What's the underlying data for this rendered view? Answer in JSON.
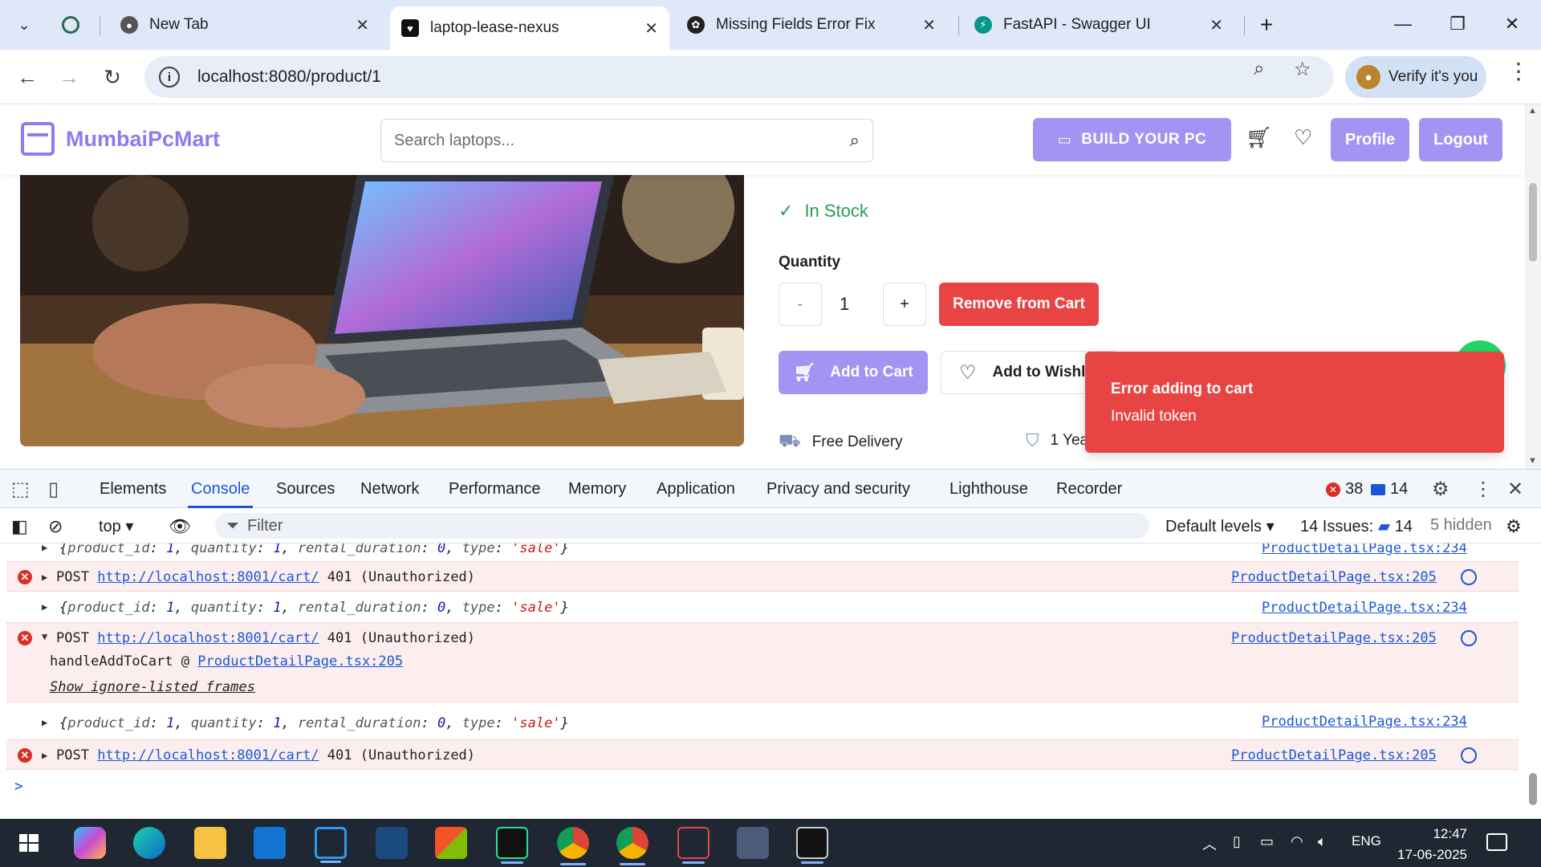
{
  "browser": {
    "tabs": [
      {
        "title": "New Tab",
        "favicon": "chrome-icon",
        "active": false
      },
      {
        "title": "laptop-lease-nexus",
        "favicon": "heart-icon",
        "active": true
      },
      {
        "title": "Missing Fields Error Fix",
        "favicon": "openai-icon",
        "active": false
      },
      {
        "title": "FastAPI - Swagger UI",
        "favicon": "fastapi-icon",
        "active": false
      }
    ],
    "new_tab_symbol": "+",
    "url": "localhost:8080/product/1",
    "profile_chip": "Verify it's you"
  },
  "site": {
    "brand": "MumbaiPcMart",
    "search_placeholder": "Search laptops...",
    "build_pc": "BUILD YOUR PC",
    "profile": "Profile",
    "logout": "Logout"
  },
  "product": {
    "stock": "In Stock",
    "quantity_label": "Quantity",
    "minus": "-",
    "quantity": "1",
    "plus": "+",
    "remove_from_cart": "Remove from Cart",
    "add_to_cart": "Add to Cart",
    "add_to_wishlist": "Add to Wishli",
    "free_delivery": "Free Delivery",
    "warranty": "1 Yea"
  },
  "toast": {
    "title": "Error adding to cart",
    "message": "Invalid token"
  },
  "devtools": {
    "tabs": [
      "Elements",
      "Console",
      "Sources",
      "Network",
      "Performance",
      "Memory",
      "Application",
      "Privacy and security",
      "Lighthouse",
      "Recorder"
    ],
    "error_count": "38",
    "message_count": "14",
    "context": "top",
    "filter_placeholder": "Filter",
    "levels": "Default levels",
    "issues_label": "14 Issues:",
    "issues_count": "14",
    "hidden": "5 hidden"
  },
  "console": {
    "obj_line": {
      "pre": "{",
      "k1": "product_id",
      "v1": "1",
      "k2": "quantity",
      "v2": "1",
      "k3": "rental_duration",
      "v3": "0",
      "k4": "type",
      "v4": "'sale'",
      "post": "}"
    },
    "post_method": "POST",
    "post_url": "http://localhost:8001/cart/",
    "post_status": "401 (Unauthorized)",
    "src_234": "ProductDetailPage.tsx:234",
    "src_205": "ProductDetailPage.tsx:205",
    "stack_fn": "handleAddToCart @",
    "stack_src": "ProductDetailPage.tsx:205",
    "show_frames": "Show ignore-listed frames"
  },
  "taskbar": {
    "time": "12:47",
    "date": "17-06-2025",
    "lang": "ENG"
  }
}
